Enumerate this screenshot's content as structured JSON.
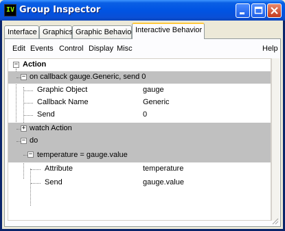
{
  "window": {
    "title": "Group Inspector",
    "icon_text": "IV"
  },
  "tabs": [
    {
      "label": "Interface"
    },
    {
      "label": "Graphics"
    },
    {
      "label": "Graphic Behavior"
    },
    {
      "label": "Interactive Behavior",
      "active": true
    }
  ],
  "menu": {
    "edit": "Edit",
    "events": "Events",
    "control": "Control",
    "display": "Display",
    "misc": "Misc",
    "help": "Help"
  },
  "tree": {
    "root": "Action",
    "callback": "on callback gauge.Generic, send 0",
    "graphic_object_label": "Graphic Object",
    "graphic_object_value": "gauge",
    "callback_name_label": "Callback Name",
    "callback_name_value": "Generic",
    "send_label": "Send",
    "send_value": "0",
    "watch": "watch Action",
    "do": "do",
    "assign": "temperature = gauge.value",
    "attribute_label": "Attribute",
    "attribute_value": "temperature",
    "send2_label": "Send",
    "send2_value": "gauge.value"
  },
  "colors": {
    "titlebar": "#0054e3",
    "highlight_row": "#c0c0c0",
    "active_tab_accent": "#ffc83c"
  }
}
